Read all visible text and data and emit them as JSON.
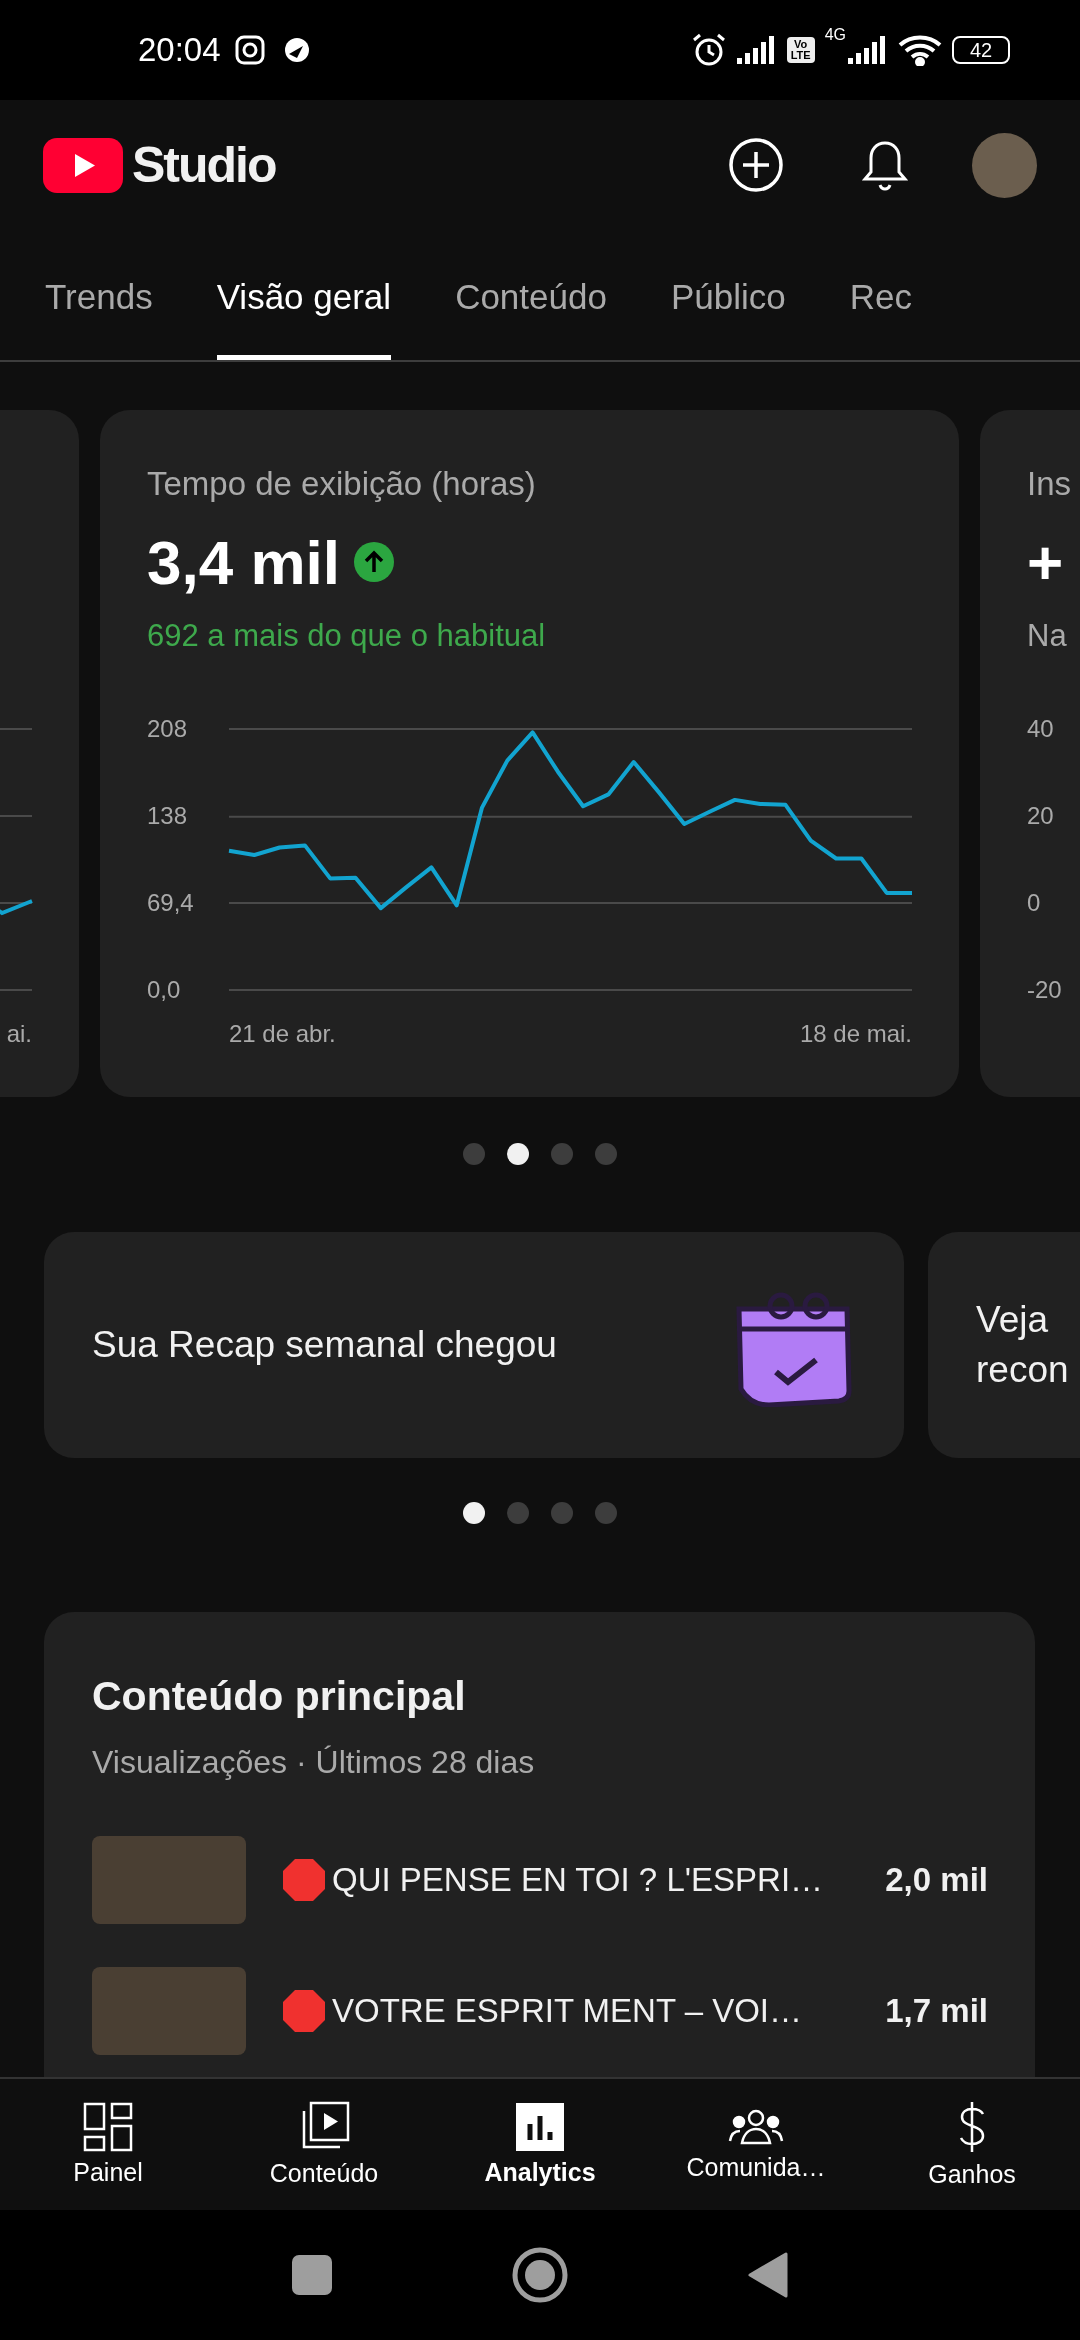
{
  "status_bar": {
    "time": "20:04",
    "volte": "Vo LTE",
    "network": "4G",
    "battery": "42"
  },
  "header": {
    "title": "Studio"
  },
  "tabs": [
    {
      "label": "Trends",
      "selected": false
    },
    {
      "label": "Visão geral",
      "selected": true
    },
    {
      "label": "Conteúdo",
      "selected": false
    },
    {
      "label": "Público",
      "selected": false
    },
    {
      "label": "Rec",
      "selected": false
    }
  ],
  "metric_cards": [
    {
      "kind": "peek_left",
      "x_labels": [
        "ai."
      ]
    },
    {
      "kind": "chart",
      "title": "Tempo de exibição (horas)",
      "value": "3,4 mil",
      "rising": true,
      "note": "692 a mais do que o habitual",
      "chart_data": {
        "type": "line",
        "series": [
          {
            "color": "#12a4d0",
            "values": [
              110.9,
              107.6,
              113.6,
              115.2,
              88.9,
              89.5,
              65.3,
              81.8,
              97.7,
              67.5,
              145.4,
              182.8,
              205.3,
              174.0,
              146.5,
              155.9,
              181.7,
              157.5,
              132.3,
              142.1,
              151.5,
              148.2,
              147.6,
              119.1,
              104.8,
              104.8,
              77.4,
              77.4
            ]
          }
        ],
        "ylim": [
          0,
          208
        ],
        "yticks": [
          {
            "value": 0,
            "label": "0,0"
          },
          {
            "value": 69.4,
            "label": "69,4"
          },
          {
            "value": 138,
            "label": "138"
          },
          {
            "value": 208,
            "label": "208"
          }
        ]
      },
      "x_labels": [
        "21 de abr.",
        "18 de mai."
      ]
    },
    {
      "kind": "peek_right",
      "title": "Ins",
      "value": "+",
      "note": "Na",
      "y_labels": [
        "40",
        "20",
        "0",
        "-20"
      ]
    }
  ],
  "metric_dots": [
    {
      "selected": false
    },
    {
      "selected": true
    },
    {
      "selected": false
    },
    {
      "selected": false
    }
  ],
  "recap_cards": [
    {
      "kind": "recap",
      "text": "Sua Recap semanal chegou"
    },
    {
      "kind": "peek",
      "text": "Veja\nrecon"
    }
  ],
  "recap_dots": [
    {
      "selected": true
    },
    {
      "selected": false
    },
    {
      "selected": false
    },
    {
      "selected": false
    }
  ],
  "top_content": {
    "title": "Conteúdo principal",
    "subtitle": "Visualizações · Últimos 28 dias",
    "rows": [
      {
        "title": "QUI PENSE EN TOI ? L'ESPRI…",
        "views": "2,0 mil"
      },
      {
        "title": "VOTRE ESPRIT MENT – VOI…",
        "views": "1,7 mil"
      }
    ]
  },
  "bottom_nav": [
    {
      "kind": "dashboard",
      "label": "Painel",
      "selected": false
    },
    {
      "kind": "content",
      "label": "Conteúdo",
      "selected": false
    },
    {
      "kind": "analytics",
      "label": "Analytics",
      "selected": true
    },
    {
      "kind": "community",
      "label": "Comunida…",
      "selected": false
    },
    {
      "kind": "earnings",
      "label": "Ganhos",
      "selected": false
    }
  ]
}
